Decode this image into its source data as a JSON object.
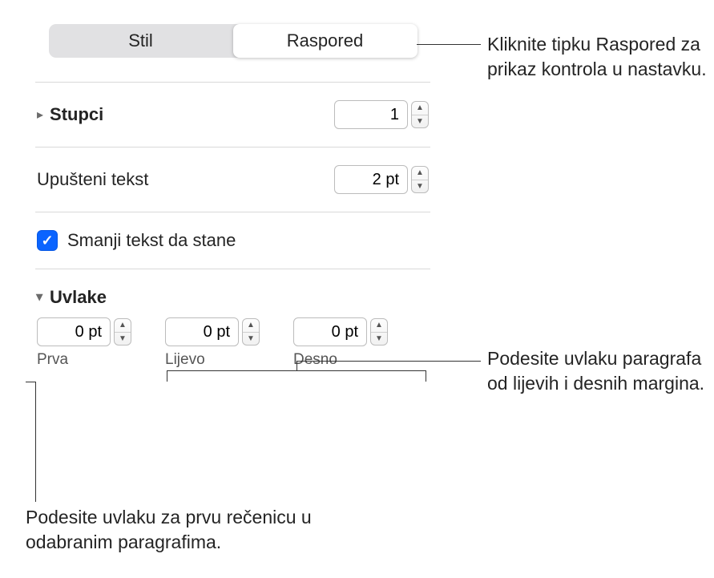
{
  "tabs": {
    "stil": "Stil",
    "raspored": "Raspored"
  },
  "columns": {
    "label": "Stupci",
    "value": "1"
  },
  "inset": {
    "label": "Upušteni tekst",
    "value": "2 pt"
  },
  "shrink": {
    "label": "Smanji tekst da stane",
    "checked": true
  },
  "indents": {
    "heading": "Uvlake",
    "first": {
      "value": "0 pt",
      "label": "Prva"
    },
    "left": {
      "value": "0 pt",
      "label": "Lijevo"
    },
    "right": {
      "value": "0 pt",
      "label": "Desno"
    }
  },
  "callouts": {
    "top": "Kliknite tipku Raspored za prikaz kontrola u nastavku.",
    "margins": "Podesite uvlaku paragrafa od lijevih i desnih margina.",
    "first": "Podesite uvlaku za prvu rečenicu u odabranim paragrafima."
  }
}
